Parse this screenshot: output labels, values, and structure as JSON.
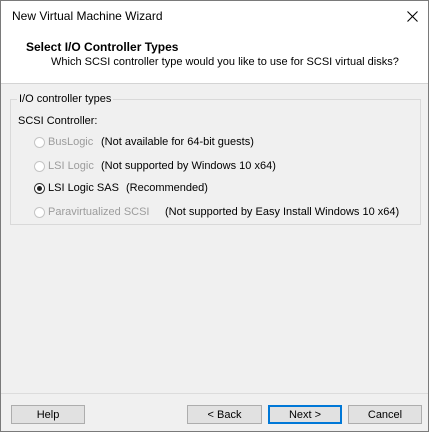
{
  "window": {
    "title": "New Virtual Machine Wizard"
  },
  "header": {
    "title": "Select I/O Controller Types",
    "subtitle": "Which SCSI controller type would you like to use for SCSI virtual disks?"
  },
  "group": {
    "legend": "I/O controller types",
    "scsi_label": "SCSI Controller:",
    "options": [
      {
        "label": "BusLogic",
        "note": "(Not available for 64-bit guests)",
        "enabled": false,
        "selected": false
      },
      {
        "label": "LSI Logic",
        "note": "(Not supported by Windows 10 x64)",
        "enabled": false,
        "selected": false
      },
      {
        "label": "LSI Logic SAS",
        "note": "(Recommended)",
        "enabled": true,
        "selected": true
      },
      {
        "label": "Paravirtualized SCSI",
        "note": "(Not supported by Easy Install Windows 10 x64)",
        "enabled": false,
        "selected": false
      }
    ]
  },
  "buttons": {
    "help": "Help",
    "back": "< Back",
    "next": "Next >",
    "cancel": "Cancel"
  },
  "colors": {
    "accent": "#0078d7",
    "disabled_text": "#9c9c9c"
  }
}
